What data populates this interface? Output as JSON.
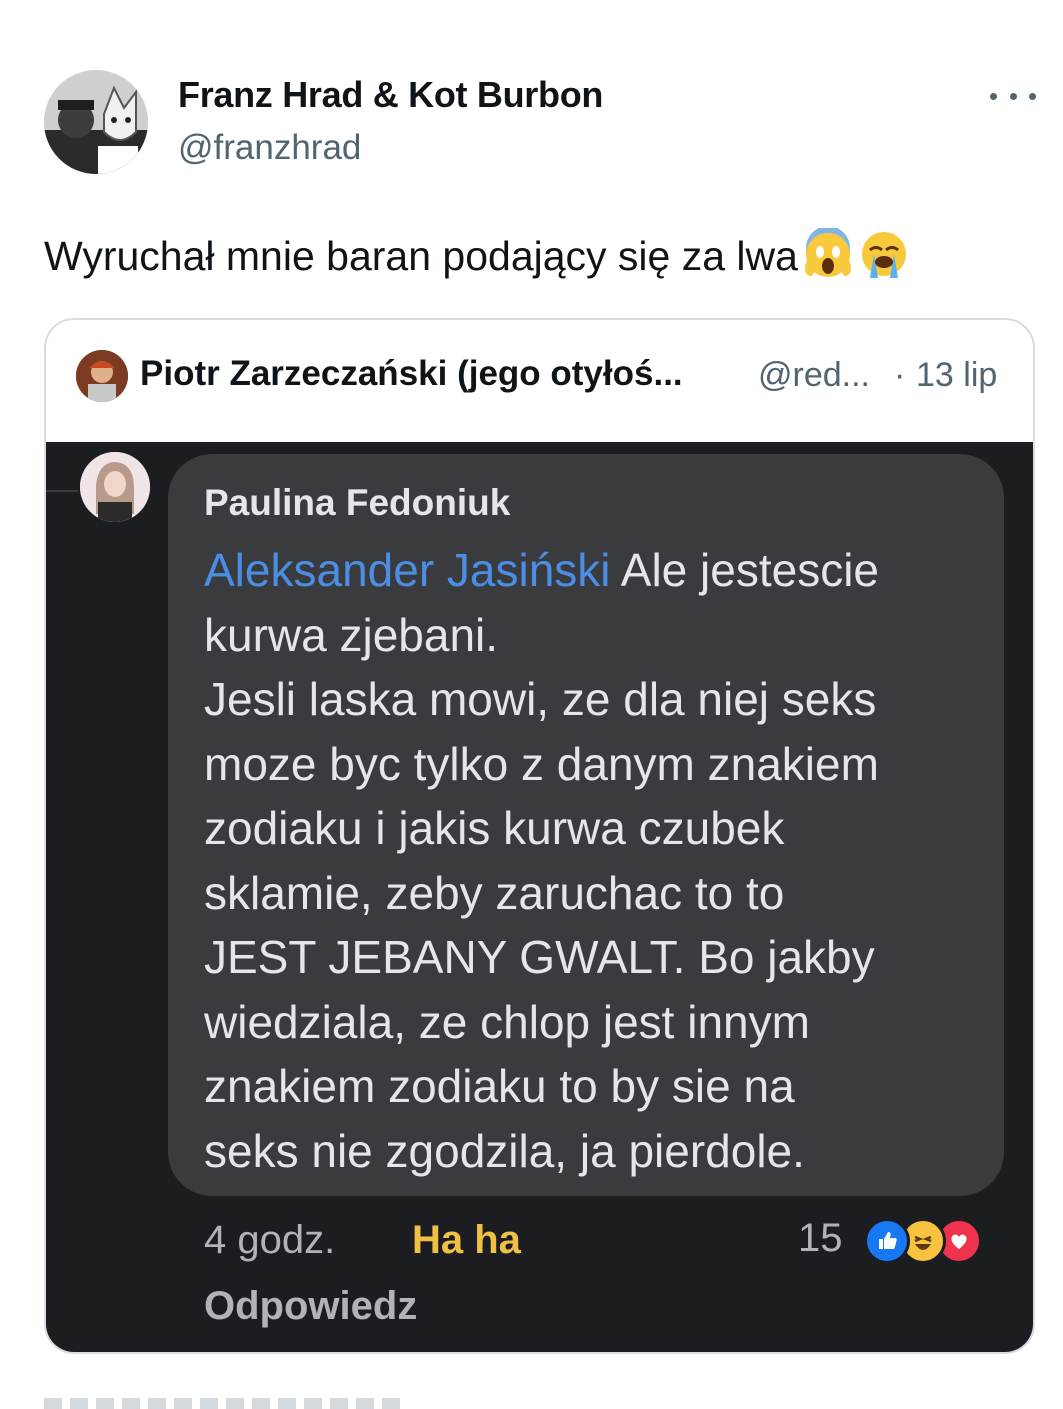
{
  "tweet": {
    "author_name": "Franz Hrad & Kot Burbon",
    "author_handle": "@franzhrad",
    "text": "Wyruchał mnie baran podający się za lwa",
    "emojis": [
      "screaming-face-emoji",
      "loudly-crying-face-emoji"
    ]
  },
  "quote": {
    "author_name": "Piotr Zarzeczański (jego otyłoś...",
    "author_handle": "@red...",
    "separator": "·",
    "date": "13 lip",
    "media": {
      "commenter": "Paulina Fedoniuk",
      "mention": "Aleksander Jasiński",
      "lines": [
        " Ale jestescie",
        "kurwa zjebani.",
        "Jesli laska mowi, ze dla niej seks",
        "moze byc tylko z danym znakiem",
        "zodiaku i jakis kurwa czubek",
        "sklamie, zeby zaruchac to to",
        "JEST JEBANY GWALT. Bo jakby",
        "wiedziala, ze chlop jest innym",
        "znakiem zodiaku to by sie na",
        "seks nie zgodzila, ja pierdole."
      ],
      "time": "4 godz.",
      "reaction_label": "Ha ha",
      "reply_label": "Odpowiedz",
      "reaction_count": "15",
      "reaction_icons": [
        "like-icon",
        "haha-icon",
        "love-icon"
      ],
      "colors": {
        "mention": "#4b8ee3",
        "haha": "#f0c044",
        "bubble": "#3a3b3e",
        "background": "#1c1d21"
      }
    }
  }
}
